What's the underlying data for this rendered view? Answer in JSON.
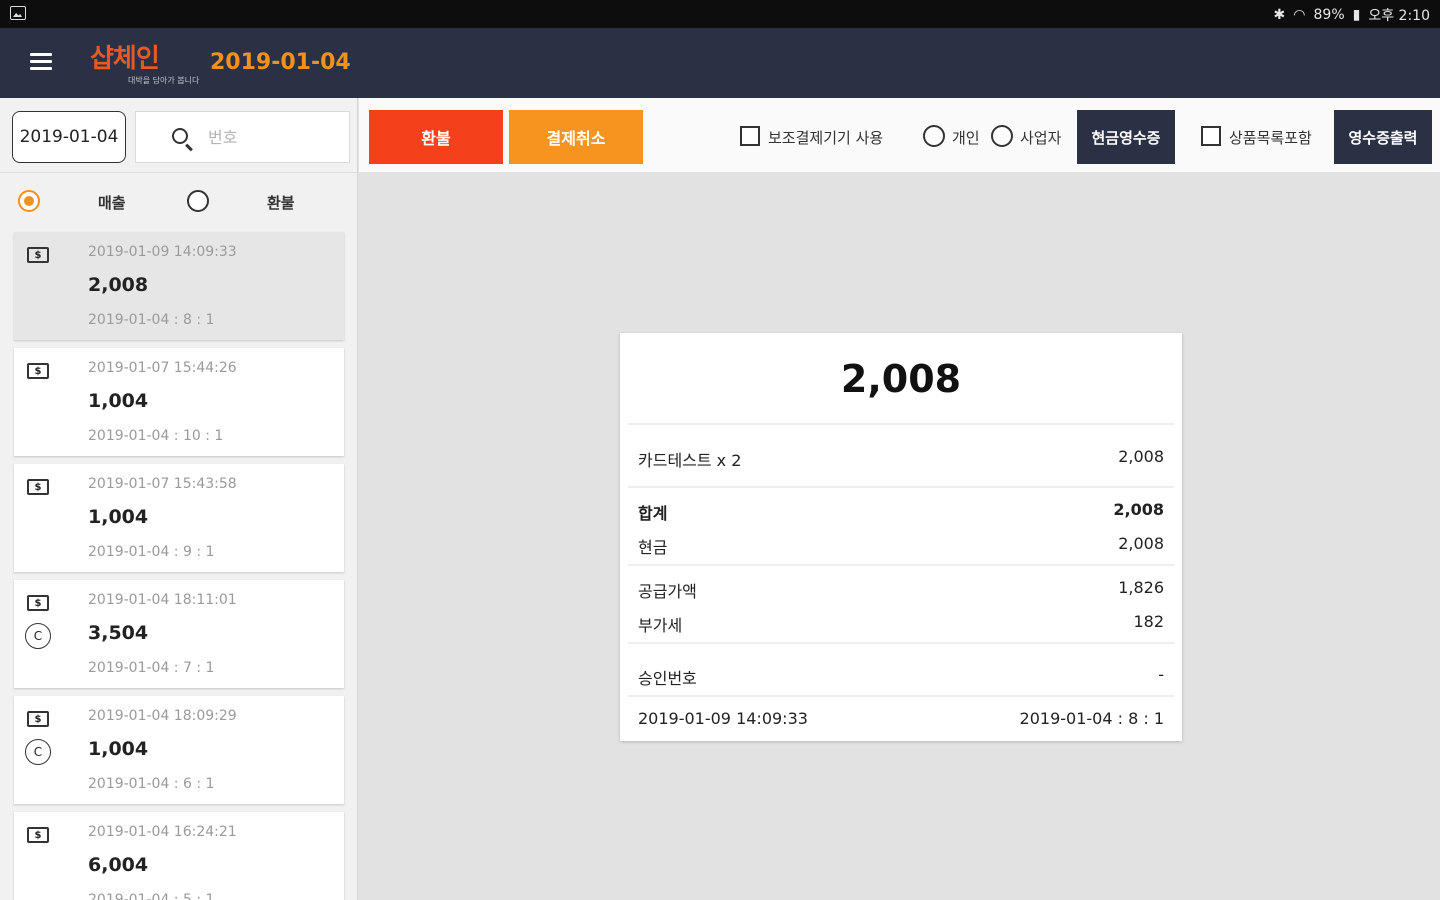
{
  "status_bar": {
    "bluetooth_icon": "bluetooth-icon",
    "wifi_icon": "wifi-icon",
    "battery": "89%",
    "time": "오후 2:10"
  },
  "app_bar": {
    "menu_icon": "hamburger-menu-icon",
    "logo_text": "샵체인",
    "logo_tagline": "대박을 담아가 봅니다",
    "date": "2019-01-04"
  },
  "left_panel": {
    "date_value": "2019-01-04",
    "search_placeholder": "번호",
    "filter": {
      "options": [
        {
          "label": "매출",
          "selected": true
        },
        {
          "label": "환불",
          "selected": false
        }
      ]
    },
    "transactions": [
      {
        "time": "2019-01-09 14:09:33",
        "amount": "2,008",
        "ref": "2019-01-04 : 8 : 1",
        "icons": [
          "cash-icon"
        ],
        "selected": true
      },
      {
        "time": "2019-01-07 15:44:26",
        "amount": "1,004",
        "ref": "2019-01-04 : 10 : 1",
        "icons": [
          "cash-icon"
        ],
        "selected": false
      },
      {
        "time": "2019-01-07 15:43:58",
        "amount": "1,004",
        "ref": "2019-01-04 : 9 : 1",
        "icons": [
          "cash-icon"
        ],
        "selected": false
      },
      {
        "time": "2019-01-04 18:11:01",
        "amount": "3,504",
        "ref": "2019-01-04 : 7 : 1",
        "icons": [
          "cash-icon",
          "coin-icon"
        ],
        "selected": false
      },
      {
        "time": "2019-01-04 18:09:29",
        "amount": "1,004",
        "ref": "2019-01-04 : 6 : 1",
        "icons": [
          "cash-icon",
          "coin-icon"
        ],
        "selected": false
      },
      {
        "time": "2019-01-04 16:24:21",
        "amount": "6,004",
        "ref": "2019-01-04 : 5 : 1",
        "icons": [
          "cash-icon"
        ],
        "selected": false
      }
    ]
  },
  "toolbar": {
    "refund_label": "환불",
    "cancel_payment_label": "결제취소",
    "aux_device_label": "보조결제기기 사용",
    "personal_label": "개인",
    "business_label": "사업자",
    "cash_receipt_label": "현금영수증",
    "include_items_label": "상품목록포함",
    "print_receipt_label": "영수증출력",
    "colors": {
      "refund": "#f5401c",
      "cancel": "#f69420",
      "dark": "#2b3145"
    }
  },
  "receipt": {
    "total": "2,008",
    "item": {
      "name": "카드테스트 x 2",
      "amount": "2,008"
    },
    "sum_label": "합계",
    "sum_value": "2,008",
    "cash_label": "현금",
    "cash_value": "2,008",
    "supply_label": "공급가액",
    "supply_value": "1,826",
    "vat_label": "부가세",
    "vat_value": "182",
    "approval_label": "승인번호",
    "approval_value": "-",
    "datetime": "2019-01-09 14:09:33",
    "ref": "2019-01-04 : 8 : 1"
  }
}
